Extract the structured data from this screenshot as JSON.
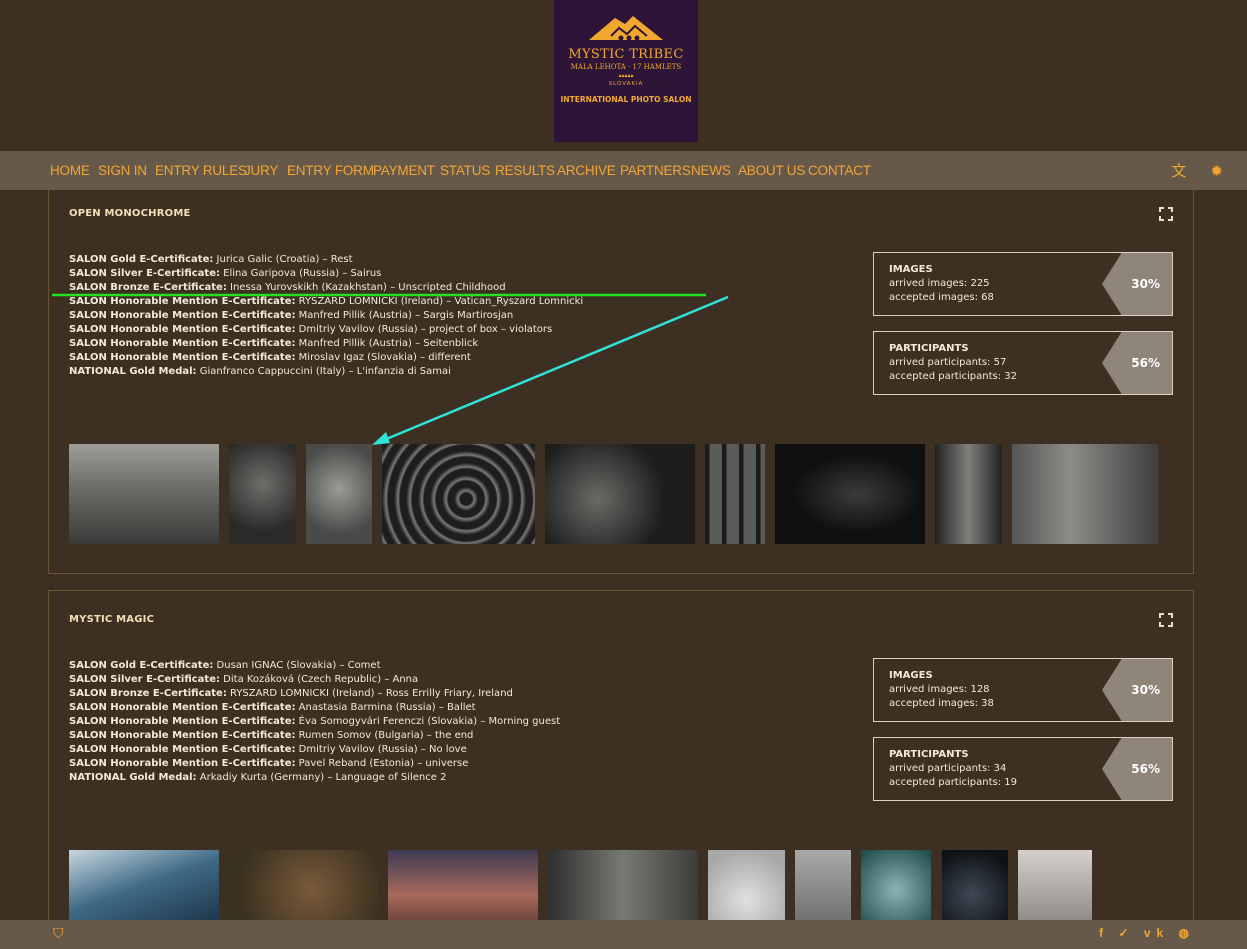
{
  "logo": {
    "title": "MYSTIC TRIBEC",
    "subtitle": "MALA LEHOTA · 17 HAMLETS",
    "country": "SLOVAKIA",
    "tagline": "INTERNATIONAL PHOTO SALON"
  },
  "nav": {
    "items": [
      "HOME",
      "SIGN IN",
      "ENTRY RULES",
      "JURY",
      "ENTRY FORM",
      "PAYMENT",
      "STATUS",
      "RESULTS",
      "ARCHIVE",
      "PARTNERS",
      "NEWS",
      "ABOUT US",
      "CONTACT"
    ],
    "icons": [
      "translate-icon",
      "bug-icon"
    ]
  },
  "sections": [
    {
      "title": "OPEN MONOCHROME",
      "results": [
        {
          "award": "SALON Gold E-Certificate:",
          "text": " Jurica Galic (Croatia) – Rest"
        },
        {
          "award": "SALON Silver E-Certificate:",
          "text": " Elina Garipova (Russia) – Sairus"
        },
        {
          "award": "SALON Bronze E-Certificate:",
          "text": " Inessa Yurovskikh (Kazakhstan) – Unscripted Childhood"
        },
        {
          "award": "SALON Honorable Mention E-Certificate:",
          "text": " RYSZARD LOMNICKI (Ireland) – Vatican_Ryszard Lomnicki"
        },
        {
          "award": "SALON Honorable Mention E-Certificate:",
          "text": " Manfred Pillik (Austria) – Sargis Martirosjan"
        },
        {
          "award": "SALON Honorable Mention E-Certificate:",
          "text": " Dmitriy Vavilov (Russia) – project of box – violators"
        },
        {
          "award": "SALON Honorable Mention E-Certificate:",
          "text": " Manfred Pillik (Austria) – Seitenblick"
        },
        {
          "award": "SALON Honorable Mention E-Certificate:",
          "text": " Miroslav Igaz (Slovakia) – different"
        },
        {
          "award": "NATIONAL Gold Medal:",
          "text": " Gianfranco Cappuccini (Italy) – L'infanzia di Samai"
        }
      ],
      "images": {
        "label": "IMAGES",
        "line1": "arrived images: 225",
        "line2": "accepted images: 68",
        "pct": "30%",
        "fraction": 0.3
      },
      "participants": {
        "label": "PARTICIPANTS",
        "line1": "arrived participants: 57",
        "line2": "accepted participants: 32",
        "pct": "56%",
        "fraction": 0.56
      }
    },
    {
      "title": "MYSTIC MAGIC",
      "results": [
        {
          "award": "SALON Gold E-Certificate:",
          "text": " Dusan IGNAC (Slovakia) – Comet"
        },
        {
          "award": "SALON Silver E-Certificate:",
          "text": " Dita Kozáková (Czech Republic) – Anna"
        },
        {
          "award": "SALON Bronze E-Certificate:",
          "text": " RYSZARD LOMNICKI (Ireland) – Ross Errilly Friary, Ireland"
        },
        {
          "award": "SALON Honorable Mention E-Certificate:",
          "text": " Anastasia Barmina (Russia) – Ballet"
        },
        {
          "award": "SALON Honorable Mention E-Certificate:",
          "text": " Éva Somogyvári Ferenczi (Slovakia) – Morning guest"
        },
        {
          "award": "SALON Honorable Mention E-Certificate:",
          "text": " Rumen Somov (Bulgaria) – the end"
        },
        {
          "award": "SALON Honorable Mention E-Certificate:",
          "text": " Dmitriy Vavilov (Russia) – No love"
        },
        {
          "award": "SALON Honorable Mention E-Certificate:",
          "text": " Pavel Reband (Estonia) – universe"
        },
        {
          "award": "NATIONAL Gold Medal:",
          "text": " Arkadiy Kurta (Germany) – Language of Silence 2"
        }
      ],
      "images": {
        "label": "IMAGES",
        "line1": "arrived images: 128",
        "line2": "accepted images: 38",
        "pct": "30%",
        "fraction": 0.3
      },
      "participants": {
        "label": "PARTICIPANTS",
        "line1": "arrived participants: 34",
        "line2": "accepted participants: 19",
        "pct": "56%",
        "fraction": 0.56
      }
    }
  ],
  "footer": {
    "left_icon": "shield-icon",
    "social": [
      "facebook-icon",
      "twitter-icon",
      "vk-icon",
      "globe-icon"
    ],
    "social_glyphs": "f ✓ vk ◍"
  },
  "annotations": {
    "underline_color": "#22e024",
    "arrow_color": "#2fe3d8"
  }
}
